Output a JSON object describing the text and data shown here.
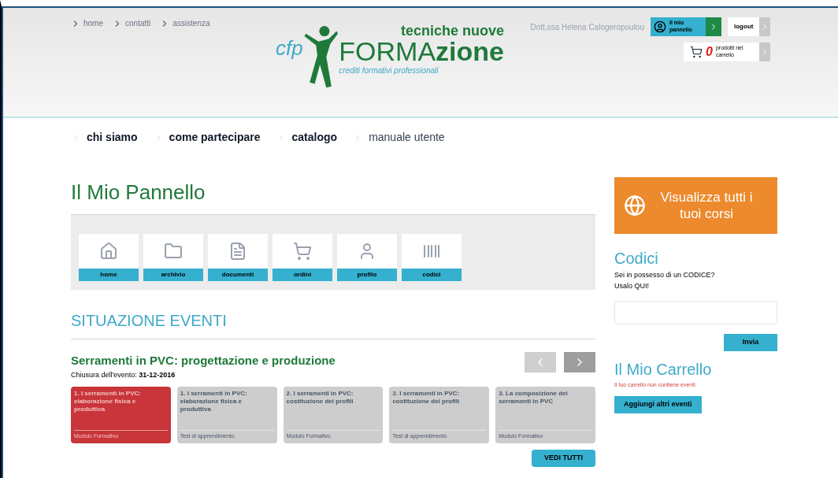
{
  "top_links": [
    "home",
    "contatti",
    "assistenza"
  ],
  "logo": {
    "prefix": "cfp",
    "top": "tecniche nuove",
    "main_light": "FORMA",
    "main_bold": "zione",
    "tagline": "crediti formativi professionali"
  },
  "user": {
    "name": "Dott.ssa Helena Calogeropoulou",
    "panel_button": "Il mio pannello",
    "logout": "logout",
    "cart_count": "0",
    "cart_label": "prodotti nel carrello"
  },
  "main_nav": [
    "chi siamo",
    "come partecipare",
    "catalogo",
    "manuale utente"
  ],
  "page_title": "Il Mio Pannello",
  "tiles": [
    {
      "kind": "home",
      "label": "home"
    },
    {
      "kind": "archive",
      "label": "archivio"
    },
    {
      "kind": "documents",
      "label": "documenti"
    },
    {
      "kind": "orders",
      "label": "ordini"
    },
    {
      "kind": "profile",
      "label": "profilo"
    },
    {
      "kind": "codes",
      "label": "codici"
    }
  ],
  "section_title": "SITUAZIONE EVENTI",
  "event": {
    "title": "Serramenti in PVC: progettazione e produzione",
    "closing": "Chiusura dell'evento: **31-12-2016**",
    "cards": [
      {
        "title": "1. I serramenti in PVC: elaborazione fisica e produttiva",
        "type": "Modulo Formativo",
        "selected": true
      },
      {
        "title": "1. I serramenti in PVC: elaborazione fisica e produttiva",
        "type": "Test di apprendimento",
        "selected": false
      },
      {
        "title": "2. I serramenti in PVC: costituzione dei profili",
        "type": "Modulo Formativo",
        "selected": false
      },
      {
        "title": "2. I serramenti in PVC: costituzione dei profili",
        "type": "Test di apprendimento",
        "selected": false
      },
      {
        "title": "3. La composizione dei serramenti in PVC",
        "type": "Modulo Formativo",
        "selected": false
      }
    ],
    "see_all": "VEDI TUTTI"
  },
  "sidebar": {
    "courses_button": "Visualizza tutti i tuoi corsi",
    "codes_title": "Codici",
    "codes_text": "Sei in possesso di un CODICE? Usalo QUI!",
    "submit": "Invia",
    "cart_title": "Il Mio Carrello",
    "cart_empty": "Il tuo carrello non contiene eventi",
    "add_button": "Aggiungi altri eventi"
  }
}
